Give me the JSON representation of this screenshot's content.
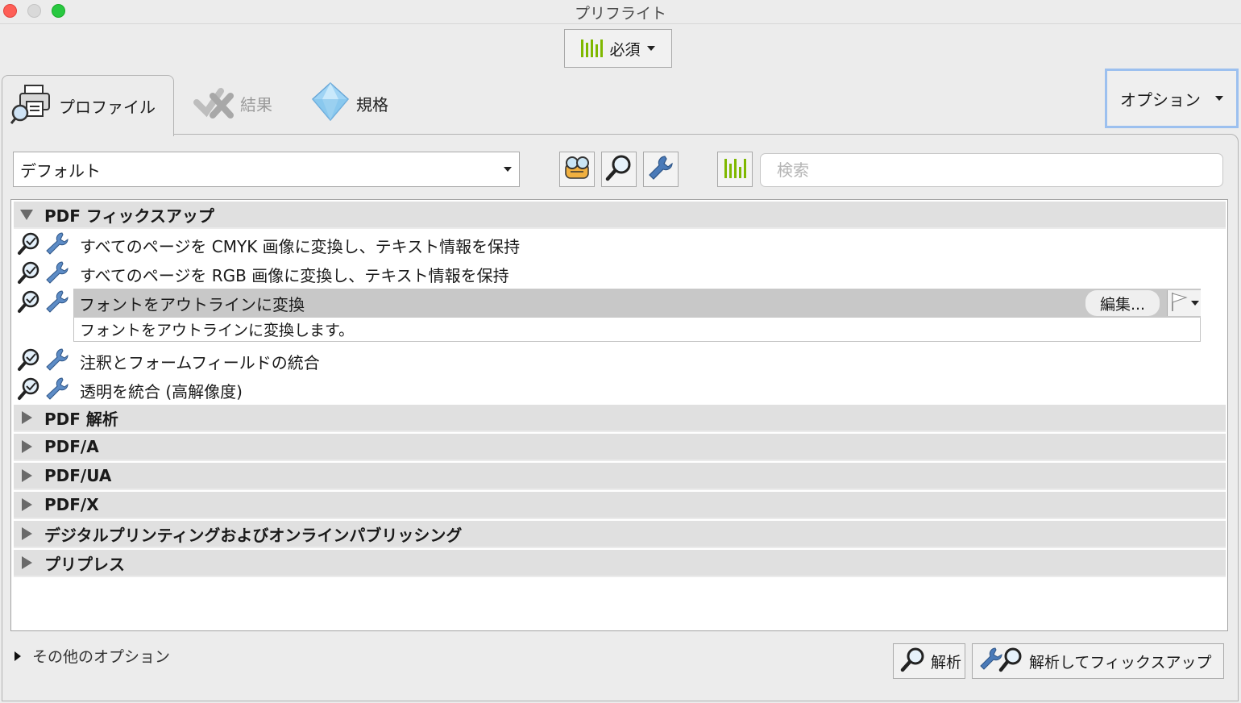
{
  "window": {
    "title": "プリフライト"
  },
  "toolbar": {
    "requirement_label": "必須"
  },
  "tabs": [
    {
      "label": "プロファイル",
      "icon": "printer-magnifier-icon",
      "active": true
    },
    {
      "label": "結果",
      "icon": "results-icon",
      "active": false
    },
    {
      "label": "規格",
      "icon": "diamond-icon",
      "active": false
    }
  ],
  "options_button": {
    "label": "オプション"
  },
  "profile_select": {
    "value": "デフォルト"
  },
  "search": {
    "placeholder": "検索"
  },
  "tree": {
    "group_pdf_fixup": "PDF フィックスアップ",
    "items": [
      "すべてのページを CMYK 画像に変換し、テキスト情報を保持",
      "すべてのページを RGB 画像に変換し、テキスト情報を保持",
      "フォントをアウトラインに変換",
      "注釈とフォームフィールドの統合",
      "透明を統合 (高解像度)"
    ],
    "selected_description": "フォントをアウトラインに変換します。",
    "edit_label": "編集...",
    "groups": [
      "PDF 解析",
      "PDF/A",
      "PDF/UA",
      "PDF/X",
      "デジタルプリンティングおよびオンラインパブリッシング",
      "プリプレス"
    ]
  },
  "footer": {
    "more_options": "その他のオプション",
    "analyze_label": "解析",
    "analyze_fix_label": "解析してフィックスアップ"
  },
  "colors": {
    "accent_green": "#7fb800",
    "focus_ring": "#9cc0ef",
    "wrench_blue": "#4a7ab8"
  }
}
